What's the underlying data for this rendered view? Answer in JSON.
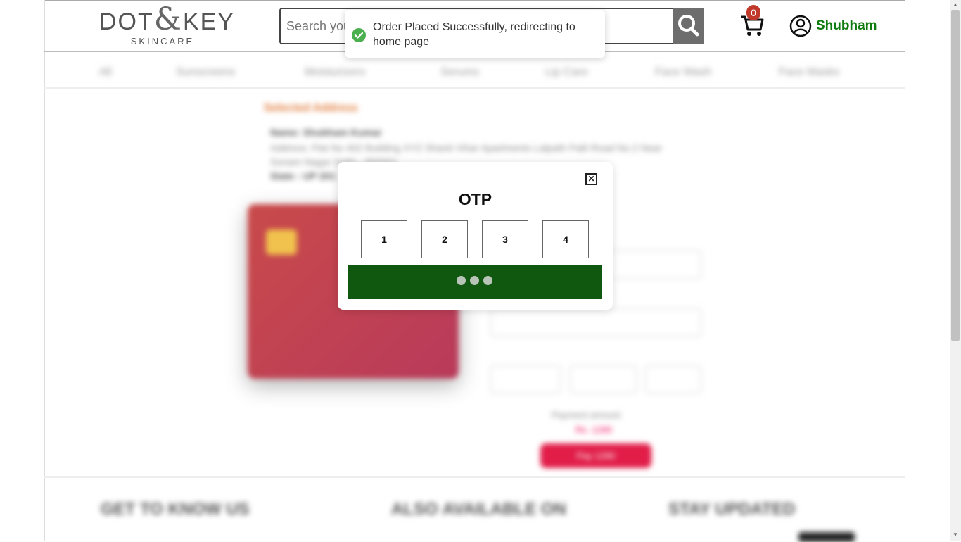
{
  "header": {
    "logo_main_left": "DOT",
    "logo_amp": "&",
    "logo_main_right": "KEY",
    "logo_sub": "SKINCARE",
    "search_placeholder": "Search your products",
    "cart_count": "0",
    "user_name": "Shubham"
  },
  "nav": {
    "items": [
      "All",
      "Sunscreens",
      "Moisturizers",
      "Serums",
      "Lip Care",
      "Face Wash",
      "Face Masks"
    ]
  },
  "checkout": {
    "selected_address_title": "Selected Address",
    "address_name": "Name: Shubham Kumar",
    "address_line": "Address: Flat No 402 Building XYZ Shanti Vihar Apartments Lalpath Patli Road No 2 Near Sonam Nagar Delhi - 800001",
    "address_state": "State : UP 201",
    "payment_amount_label": "Payment amount",
    "payment_amount_value": "Rs. 1290",
    "pay_button": "Pay 1290"
  },
  "footer": {
    "col1": "GET TO KNOW US",
    "col2": "ALSO AVAILABLE ON",
    "col3": "STAY UPDATED"
  },
  "modal": {
    "title": "OTP",
    "close_symbol": "⊠",
    "otp_digits": [
      "1",
      "2",
      "3",
      "4"
    ]
  },
  "toast": {
    "message": "Order Placed Successfully, redirecting to home page"
  },
  "colors": {
    "brand_green": "#0f7a0f",
    "submit_green": "#105710",
    "cart_badge": "#c0392b",
    "toast_success": "#4caf50",
    "pay_button": "#e11d48"
  }
}
